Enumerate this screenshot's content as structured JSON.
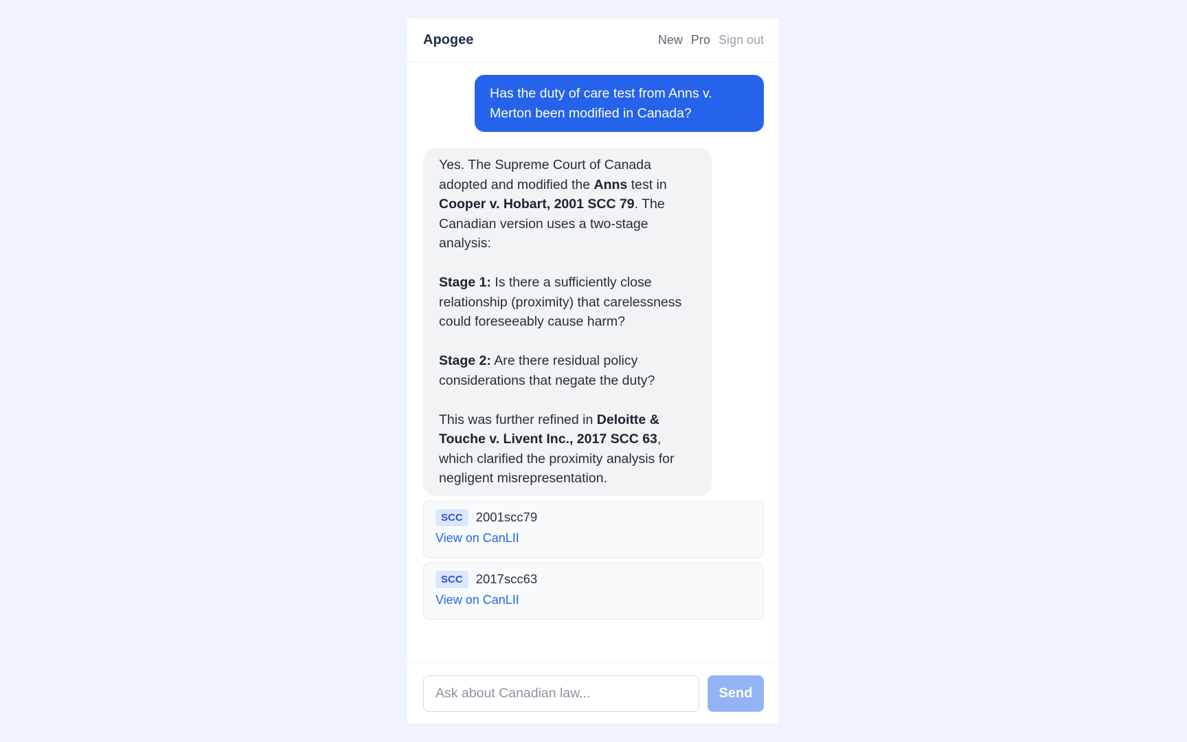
{
  "header": {
    "brand": "Apogee",
    "nav": {
      "new": "New",
      "pro": "Pro",
      "sign_out": "Sign out"
    }
  },
  "conversation": {
    "user_message": "Has the duty of care test from Anns v. Merton been modified in Canada?",
    "assistant": {
      "p1": {
        "t1": "Yes. The Supreme Court of Canada adopted and modified the ",
        "b1": "Anns",
        "t2": " test in ",
        "b2": "Cooper v. Hobart, 2001 SCC 79",
        "t3": ". The Canadian version uses a two-stage analysis:"
      },
      "p2": {
        "label": "Stage 1:",
        "text": " Is there a sufficiently close relationship (proximity) that carelessness could foreseeably cause harm?"
      },
      "p3": {
        "label": "Stage 2:",
        "text": " Are there residual policy considerations that negate the duty?"
      },
      "p4": {
        "t1": "This was further refined in ",
        "b1": "Deloitte & Touche v. Livent Inc., 2017 SCC 63",
        "t2": ", which clarified the proximity analysis for negligent misrepresentation."
      }
    },
    "citations": [
      {
        "court": "SCC",
        "id": "2001scc79",
        "link": "View on CanLII"
      },
      {
        "court": "SCC",
        "id": "2017scc63",
        "link": "View on CanLII"
      }
    ]
  },
  "composer": {
    "placeholder": "Ask about Canadian law...",
    "send_label": "Send"
  },
  "colors": {
    "accent": "#2563eb",
    "send_disabled": "#93b3f4",
    "page_bg": "#eef3fd"
  }
}
